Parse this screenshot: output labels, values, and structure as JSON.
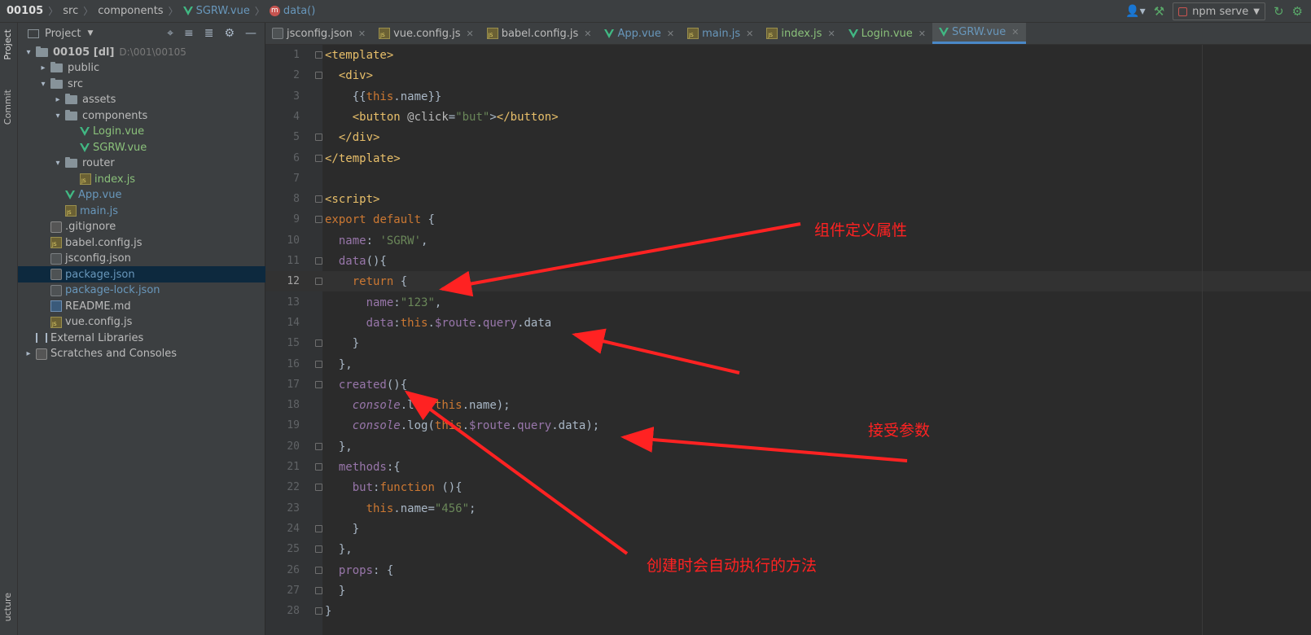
{
  "breadcrumb": {
    "items": [
      "00105",
      "src",
      "components",
      "SGRW.vue",
      "data()"
    ]
  },
  "toolbar": {
    "run_config": "npm serve",
    "icons": [
      "user-icon",
      "hammer-icon",
      "rerun-icon",
      "bug-icon"
    ]
  },
  "side_tabs": {
    "project": "Project",
    "commit": "Commit",
    "structure": "ucture"
  },
  "project_panel": {
    "title": "Project",
    "tree": [
      {
        "label": "00105 [dl]",
        "hint": "D:\\001\\00105",
        "depth": 0,
        "type": "folder",
        "expanded": true
      },
      {
        "label": "public",
        "depth": 1,
        "type": "folder",
        "expanded": false
      },
      {
        "label": "src",
        "depth": 1,
        "type": "folder",
        "expanded": true
      },
      {
        "label": "assets",
        "depth": 2,
        "type": "folder",
        "expanded": false
      },
      {
        "label": "components",
        "depth": 2,
        "type": "folder",
        "expanded": true
      },
      {
        "label": "Login.vue",
        "depth": 3,
        "type": "vue"
      },
      {
        "label": "SGRW.vue",
        "depth": 3,
        "type": "vue"
      },
      {
        "label": "router",
        "depth": 2,
        "type": "folder",
        "expanded": true
      },
      {
        "label": "index.js",
        "depth": 3,
        "type": "js"
      },
      {
        "label": "App.vue",
        "depth": 2,
        "type": "vue"
      },
      {
        "label": "main.js",
        "depth": 2,
        "type": "js"
      },
      {
        "label": ".gitignore",
        "depth": 1,
        "type": "git"
      },
      {
        "label": "babel.config.js",
        "depth": 1,
        "type": "js"
      },
      {
        "label": "jsconfig.json",
        "depth": 1,
        "type": "json"
      },
      {
        "label": "package.json",
        "depth": 1,
        "type": "json",
        "selected": true
      },
      {
        "label": "package-lock.json",
        "depth": 1,
        "type": "json"
      },
      {
        "label": "README.md",
        "depth": 1,
        "type": "md"
      },
      {
        "label": "vue.config.js",
        "depth": 1,
        "type": "js"
      },
      {
        "label": "External Libraries",
        "depth": 0,
        "type": "lib"
      },
      {
        "label": "Scratches and Consoles",
        "depth": 0,
        "type": "scratch"
      }
    ]
  },
  "tabs": [
    {
      "label": "jsconfig.json",
      "type": "json"
    },
    {
      "label": "vue.config.js",
      "type": "js"
    },
    {
      "label": "babel.config.js",
      "type": "js"
    },
    {
      "label": "App.vue",
      "type": "vue"
    },
    {
      "label": "main.js",
      "type": "js"
    },
    {
      "label": "index.js",
      "type": "js"
    },
    {
      "label": "Login.vue",
      "type": "vue"
    },
    {
      "label": "SGRW.vue",
      "type": "vue",
      "active": true
    }
  ],
  "editor": {
    "current_line": 12,
    "lines": [
      "<template>",
      "  <div>",
      "    {{this.name}}",
      "    <button @click=\"but\"></button>",
      "  </div>",
      "</template>",
      "",
      "<script>",
      "export default {",
      "  name: 'SGRW',",
      "  data(){",
      "    return {",
      "      name:\"123\",",
      "      data:this.$route.query.data",
      "    }",
      "  },",
      "  created(){",
      "    console.log(this.name);",
      "    console.log(this.$route.query.data);",
      "  },",
      "  methods:{",
      "    but:function (){",
      "      this.name=\"456\";",
      "    }",
      "  },",
      "  props: {",
      "  }",
      "}"
    ]
  },
  "annotations": [
    {
      "text": "组件定义属性"
    },
    {
      "text": "接受参数"
    },
    {
      "text": "创建时会自动执行的方法"
    }
  ]
}
